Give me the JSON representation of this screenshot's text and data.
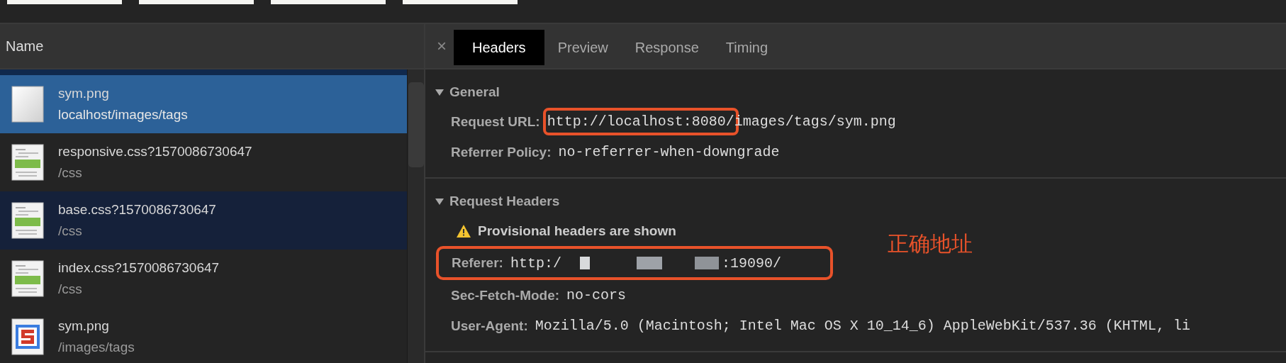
{
  "request_list": {
    "column_header": "Name",
    "rows": [
      {
        "name": "sym.png",
        "path": "localhost/images/tags",
        "kind": "blank",
        "selected": true,
        "highlighted": false
      },
      {
        "name": "responsive.css?1570086730647",
        "path": "/css",
        "kind": "css",
        "selected": false,
        "highlighted": false
      },
      {
        "name": "base.css?1570086730647",
        "path": "/css",
        "kind": "css",
        "selected": false,
        "highlighted": true
      },
      {
        "name": "index.css?1570086730647",
        "path": "/css",
        "kind": "css",
        "selected": false,
        "highlighted": false
      },
      {
        "name": "sym.png",
        "path": "/images/tags",
        "kind": "image",
        "selected": false,
        "highlighted": false
      }
    ]
  },
  "details": {
    "close": "×",
    "tabs": [
      {
        "label": "Headers",
        "selected": true
      },
      {
        "label": "Preview",
        "selected": false
      },
      {
        "label": "Response",
        "selected": false
      },
      {
        "label": "Timing",
        "selected": false
      }
    ],
    "sections": [
      {
        "title": "General",
        "expanded": true,
        "rows": [
          {
            "kind": "field",
            "label": "Request URL:",
            "annotated": false,
            "value_parts": [
              {
                "kind": "text",
                "text": "http://localhost:8080/",
                "annotated": true
              },
              {
                "kind": "text",
                "text": "images/tags/sym.png",
                "annotated": false
              }
            ]
          },
          {
            "kind": "field",
            "label": "Referrer Policy:",
            "annotated": false,
            "value_parts": [
              {
                "kind": "text",
                "text": "no-referrer-when-downgrade",
                "annotated": false
              }
            ]
          }
        ]
      },
      {
        "title": "Request Headers",
        "expanded": true,
        "rows": [
          {
            "kind": "warning",
            "text": "Provisional headers are shown"
          },
          {
            "kind": "field",
            "label": "Referer:",
            "annotated": true,
            "value_parts": [
              {
                "kind": "text",
                "text": "http:/",
                "annotated": false
              },
              {
                "kind": "redacted"
              },
              {
                "kind": "text",
                "text": ":19090/",
                "annotated": false
              }
            ]
          },
          {
            "kind": "field",
            "label": "Sec-Fetch-Mode:",
            "annotated": false,
            "value_parts": [
              {
                "kind": "text",
                "text": "no-cors",
                "annotated": false
              }
            ]
          },
          {
            "kind": "field",
            "label": "User-Agent:",
            "annotated": false,
            "value_parts": [
              {
                "kind": "text",
                "text": "Mozilla/5.0 (Macintosh; Intel Mac OS X 10_14_6) AppleWebKit/537.36 (KHTML, li",
                "annotated": false
              }
            ]
          }
        ]
      }
    ]
  },
  "annotation_note": "正确地址"
}
